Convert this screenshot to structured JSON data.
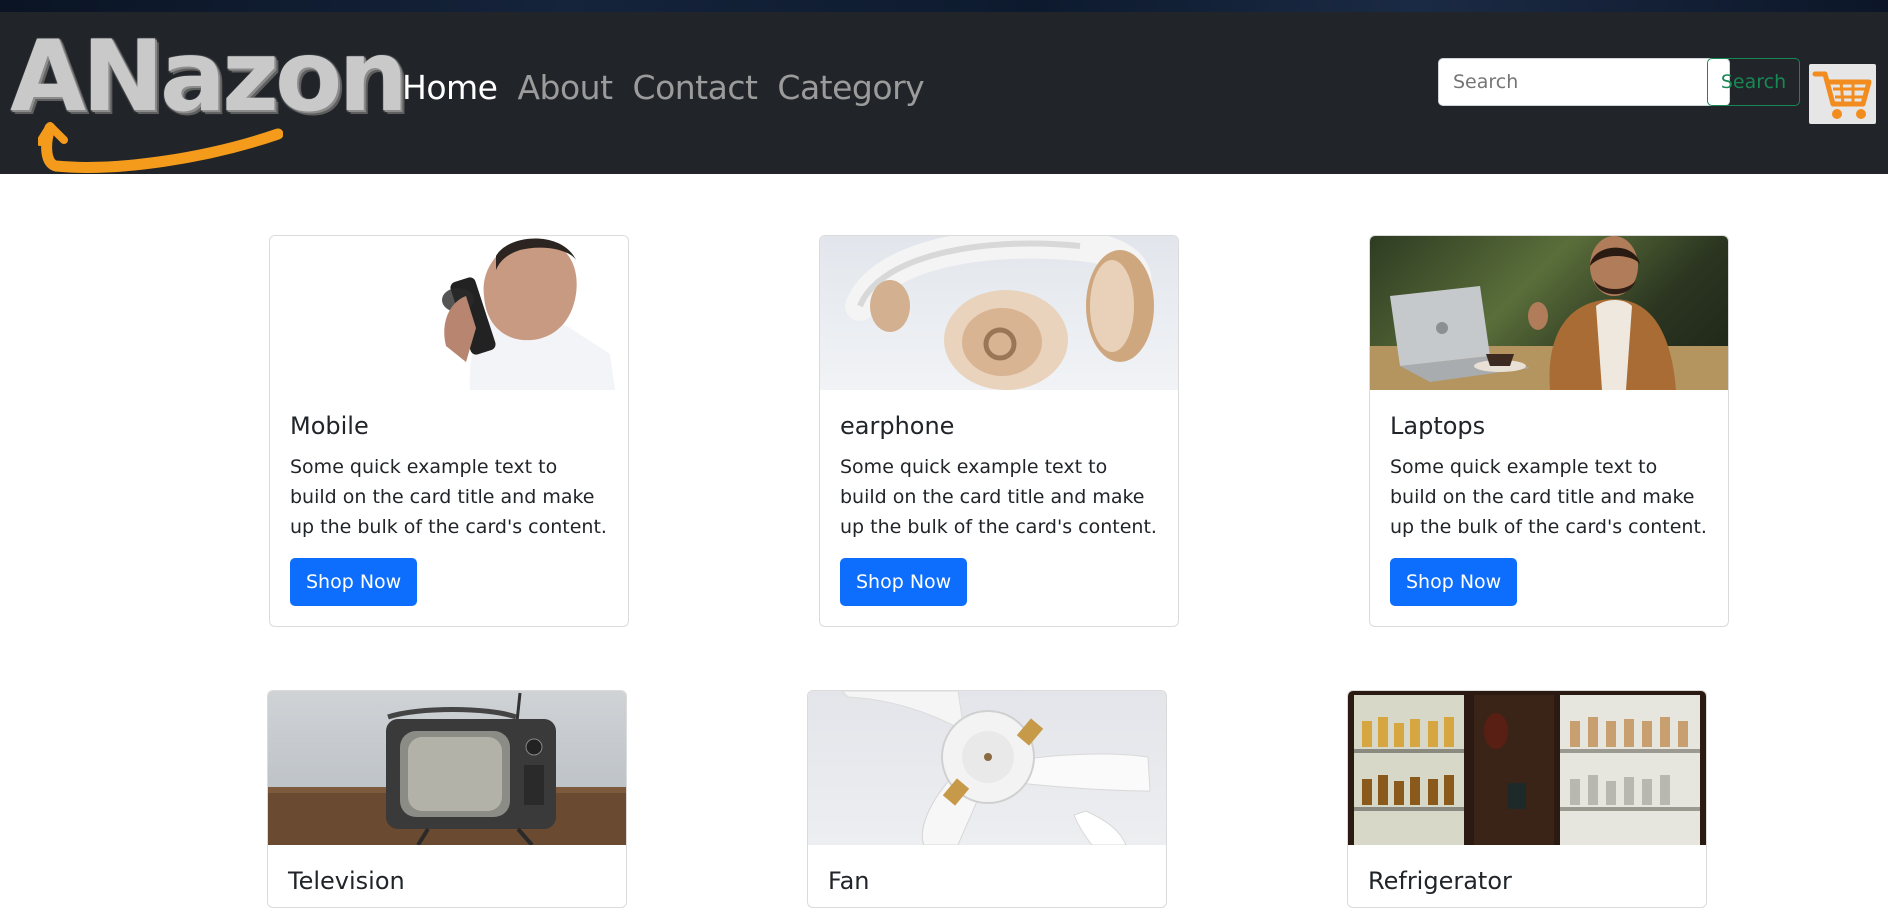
{
  "header": {
    "brand": "ANazon",
    "nav": [
      {
        "label": "Home",
        "active": true
      },
      {
        "label": "About",
        "active": false
      },
      {
        "label": "Contact",
        "active": false
      },
      {
        "label": "Category",
        "active": false
      }
    ],
    "search": {
      "placeholder": "Search",
      "button_label": "Search"
    },
    "cart_icon": "shopping-cart-icon"
  },
  "cards": [
    {
      "title": "Mobile",
      "text": "Some quick example text to build on the card title and make up the bulk of the card's content.",
      "button": "Shop Now",
      "image": "person-on-phone-photo"
    },
    {
      "title": "earphone",
      "text": "Some quick example text to build on the card title and make up the bulk of the card's content.",
      "button": "Shop Now",
      "image": "headphones-photo"
    },
    {
      "title": "Laptops",
      "text": "Some quick example text to build on the card title and make up the bulk of the card's content.",
      "button": "Shop Now",
      "image": "man-with-laptop-photo"
    },
    {
      "title": "Television",
      "image": "vintage-tv-photo"
    },
    {
      "title": "Fan",
      "image": "ceiling-fan-photo"
    },
    {
      "title": "Refrigerator",
      "image": "shelves-with-bottles-photo"
    }
  ],
  "colors": {
    "navbar_bg": "#212529",
    "primary": "#0d6efd",
    "success": "#198754",
    "brand_arrow": "#f59b1c"
  }
}
